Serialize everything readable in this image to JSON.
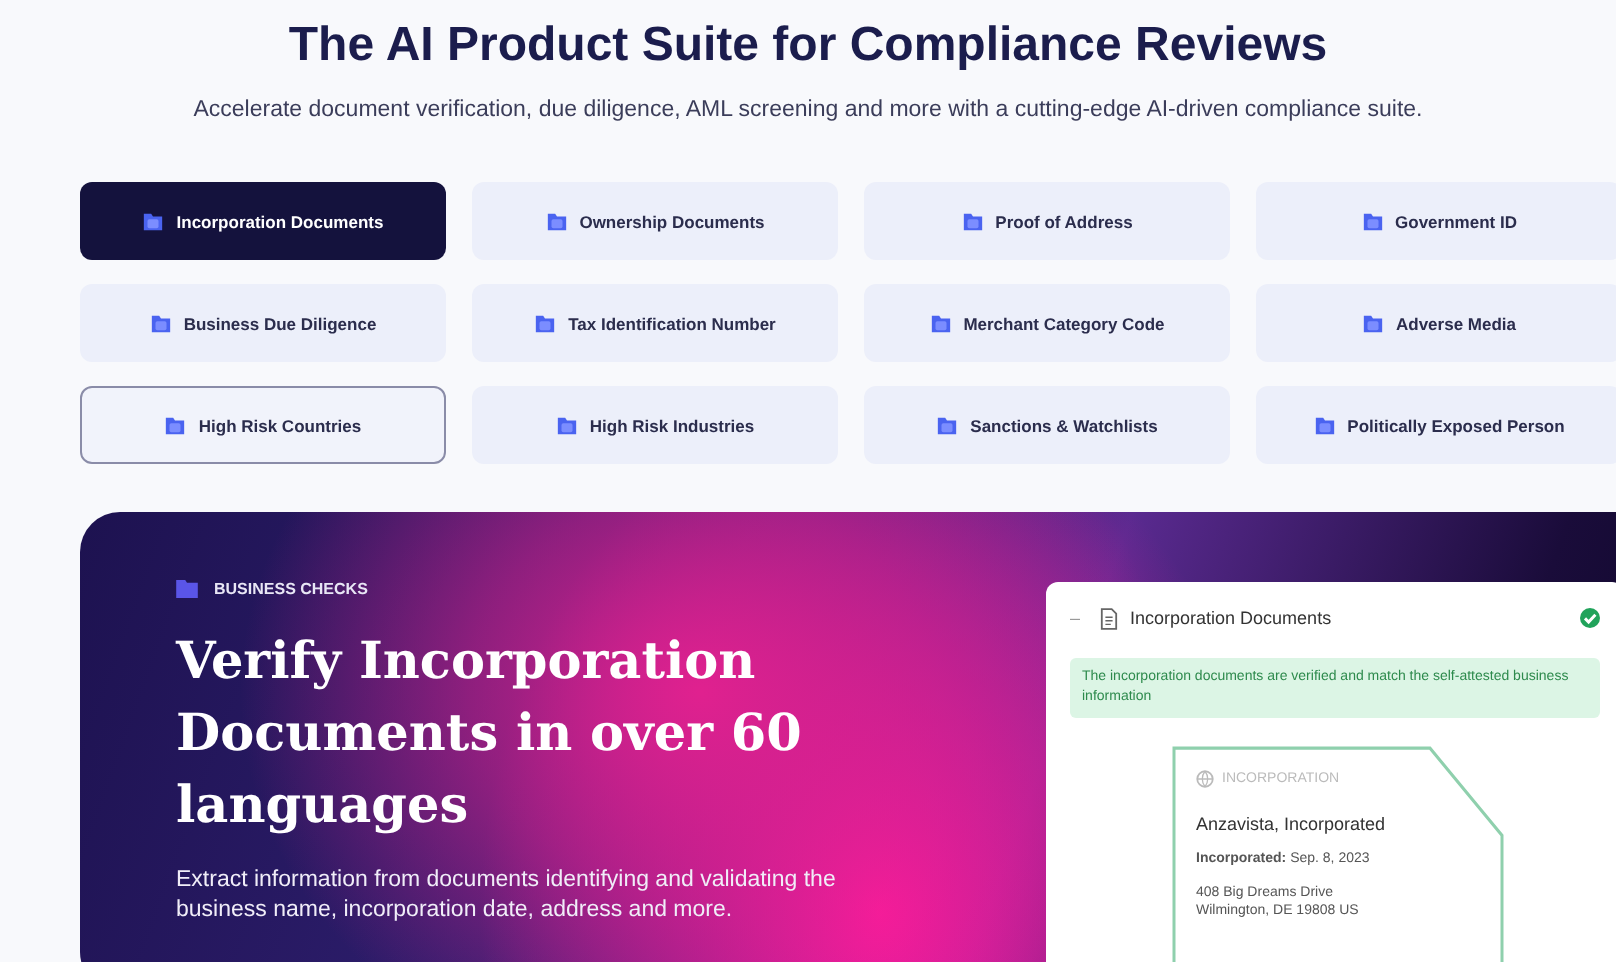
{
  "heading": "The AI Product Suite for Compliance Reviews",
  "subheading": "Accelerate document verification, due diligence, AML screening and more with a cutting-edge AI-driven compliance suite.",
  "tiles": [
    {
      "label": "Incorporation Documents",
      "selected": true,
      "focused": false
    },
    {
      "label": "Ownership Documents",
      "selected": false,
      "focused": false
    },
    {
      "label": "Proof of Address",
      "selected": false,
      "focused": false
    },
    {
      "label": "Government ID",
      "selected": false,
      "focused": false
    },
    {
      "label": "Business Due Diligence",
      "selected": false,
      "focused": false
    },
    {
      "label": "Tax Identification Number",
      "selected": false,
      "focused": false
    },
    {
      "label": "Merchant Category Code",
      "selected": false,
      "focused": false
    },
    {
      "label": "Adverse Media",
      "selected": false,
      "focused": false
    },
    {
      "label": "High Risk Countries",
      "selected": false,
      "focused": true
    },
    {
      "label": "High Risk Industries",
      "selected": false,
      "focused": false
    },
    {
      "label": "Sanctions & Watchlists",
      "selected": false,
      "focused": false
    },
    {
      "label": "Politically Exposed Person",
      "selected": false,
      "focused": false
    }
  ],
  "hero": {
    "eyebrow": "BUSINESS CHECKS",
    "title": "Verify Incorporation Documents in over 60 languages",
    "description": "Extract information from documents identifying and validating the business name, incorporation date, address and more.",
    "card": {
      "collapse": "–",
      "title": "Incorporation Documents",
      "verified": true,
      "note": "The incorporation documents are verified and match the self-attested business information",
      "document": {
        "label": "INCORPORATION",
        "company": "Anzavista, Incorporated",
        "date": "**Incorporated:** Sep. 8, 2023",
        "address_lines": [
          "408 Big Dreams Drive",
          "Wilmington, DE 19808 US"
        ]
      }
    }
  }
}
